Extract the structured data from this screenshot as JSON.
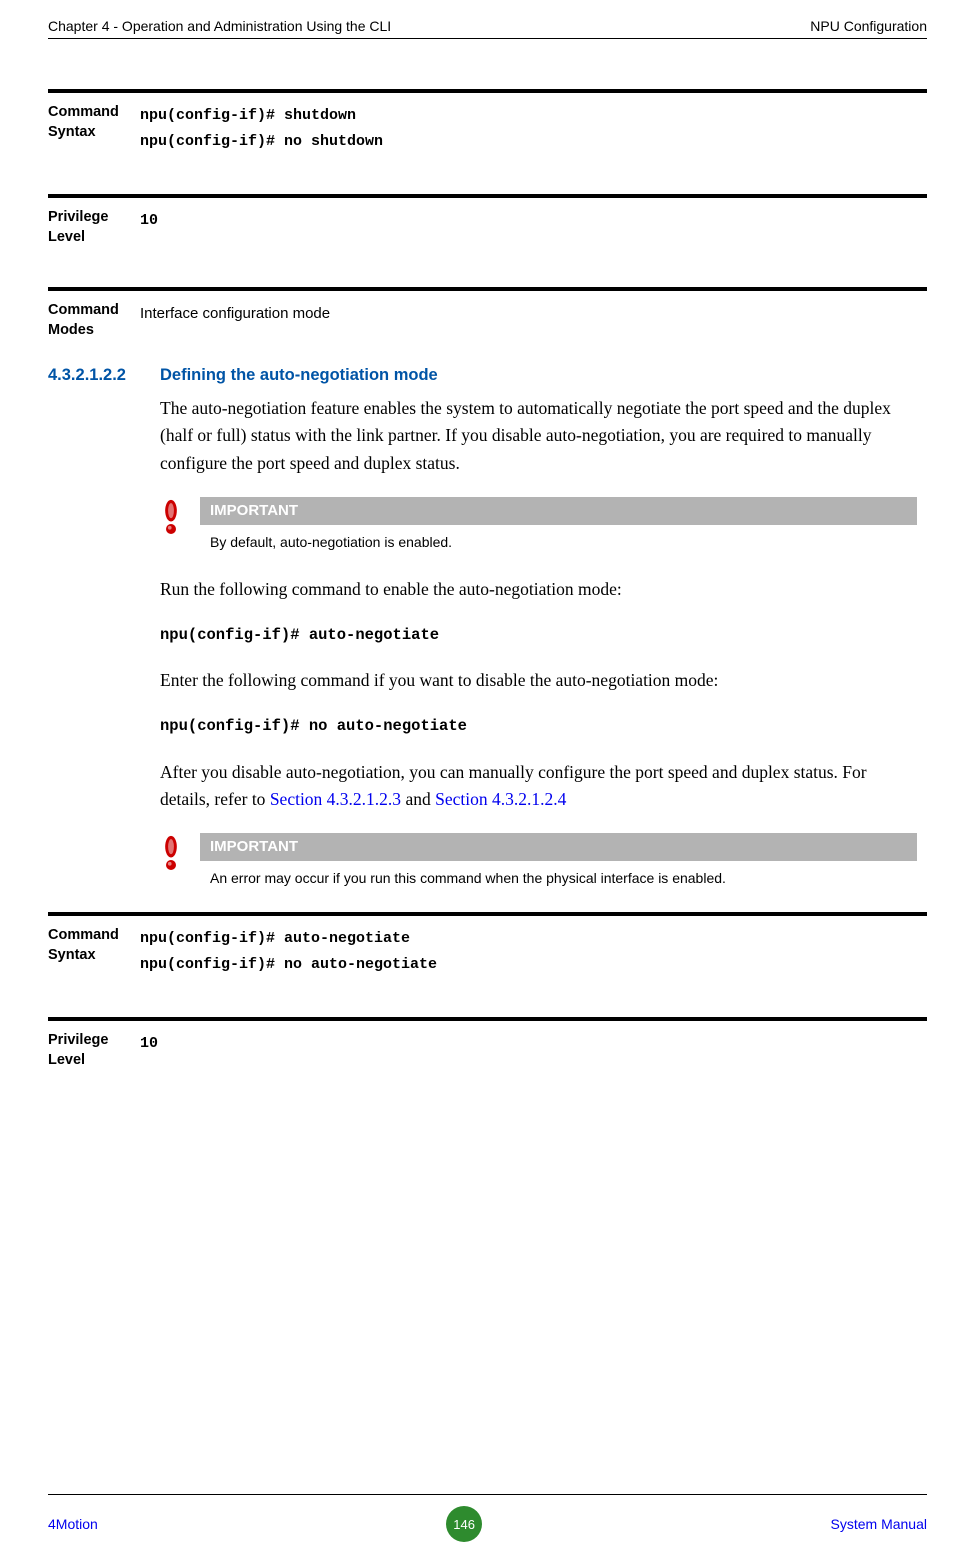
{
  "header": {
    "left": "Chapter 4 - Operation and Administration Using the CLI",
    "right": "NPU Configuration"
  },
  "blocks": {
    "cmd_syntax_1": {
      "label_l1": "Command",
      "label_l2": "Syntax",
      "line1": "npu(config-if)# shutdown",
      "line2": "npu(config-if)# no shutdown"
    },
    "priv_level_1": {
      "label_l1": "Privilege",
      "label_l2": "Level",
      "value": "10"
    },
    "cmd_modes": {
      "label_l1": "Command",
      "label_l2": "Modes",
      "value": "Interface configuration mode"
    }
  },
  "section": {
    "num": "4.3.2.1.2.2",
    "title": "Defining the auto-negotiation mode",
    "para1": "The auto-negotiation feature enables the system to automatically negotiate the port speed and the duplex (half or full) status with the link partner. If you disable auto-negotiation, you are required to manually configure the port speed and duplex status.",
    "note1": {
      "head": "IMPORTANT",
      "text": "By default, auto-negotiation is enabled."
    },
    "para2": "Run the following command to enable the auto-negotiation mode:",
    "cmd1": "npu(config-if)# auto-negotiate",
    "para3": "Enter the following command if you want to disable the auto-negotiation mode:",
    "cmd2": "npu(config-if)# no auto-negotiate",
    "para4_pre": "After you disable auto-negotiation, you can manually configure the port speed and duplex status. For details, refer to ",
    "para4_link1": "Section 4.3.2.1.2.3",
    "para4_mid": " and ",
    "para4_link2": "Section 4.3.2.1.2.4",
    "note2": {
      "head": "IMPORTANT",
      "text": "An error may occur if you run this command when the physical interface is enabled."
    },
    "cmd_syntax_2": {
      "label_l1": "Command",
      "label_l2": "Syntax",
      "line1": "npu(config-if)# auto-negotiate",
      "line2": "npu(config-if)# no auto-negotiate"
    },
    "priv_level_2": {
      "label_l1": "Privilege",
      "label_l2": "Level",
      "value": "10"
    }
  },
  "footer": {
    "left": "4Motion",
    "page": "146",
    "right": "System Manual"
  }
}
